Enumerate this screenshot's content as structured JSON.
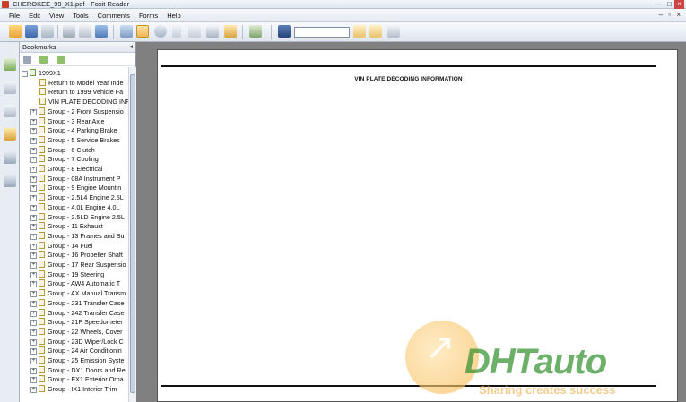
{
  "window": {
    "title": "CHEROKEE_99_X1.pdf - Foxit Reader"
  },
  "menubar": {
    "items": [
      "File",
      "Edit",
      "View",
      "Tools",
      "Comments",
      "Forms",
      "Help"
    ]
  },
  "toolbar": {
    "search_value": ""
  },
  "panel": {
    "title": "Bookmarks"
  },
  "bookmarks": {
    "root": "1999X1",
    "items": [
      "Return to Model Year Inde",
      "Return to 1999 Vehicle Fa",
      "VIN PLATE DECODING INF",
      "Group - 2 Front Suspensio",
      "Group - 3 Rear Axle",
      "Group - 4 Parking Brake",
      "Group - 5 Service Brakes",
      "Group - 6 Clutch",
      "Group - 7 Cooling",
      "Group - 8 Electrical",
      "Group - 08A Instrument P",
      "Group - 9 Engine Mountin",
      "Group - 2.5L4 Engine 2.5L",
      "Group - 4.0L Engine 4.0L",
      "Group - 2.5LD Engine 2.5L",
      "Group - 11 Exhaust",
      "Group - 13 Frames and Bu",
      "Group - 14 Fuel",
      "Group - 16 Propeller Shaft",
      "Group - 17 Rear Suspensio",
      "Group - 19 Steering",
      "Group - AW4 Automatic T",
      "Group - AX Manual Transm",
      "Group - 231 Transfer Case",
      "Group - 242 Transfer Case",
      "Group - 21P Speedometer",
      "Group - 22 Wheels, Cover",
      "Group - 23D Wiper/Lock C",
      "Group - 24 Air Conditionin",
      "Group - 25 Emission Syste",
      "Group - DX1 Doors and Re",
      "Group - EX1 Exterior Orna",
      "Group - IX1 Interior Trim"
    ]
  },
  "document": {
    "page_title": "VIN PLATE DECODING INFORMATION"
  },
  "watermark": {
    "logo": "DHTauto",
    "slogan": "Sharing creates success"
  },
  "colors": {
    "accent": "#2f8f2a",
    "watermark_orange": "#f5b54a",
    "viewer_bg": "#808080"
  }
}
